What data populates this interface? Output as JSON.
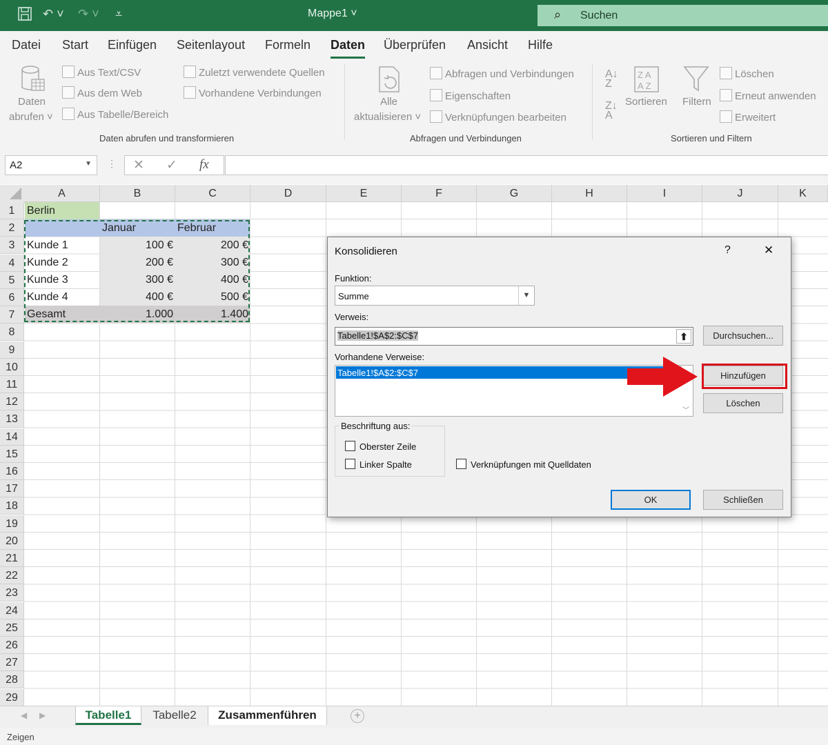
{
  "app": {
    "doc_title": "Mappe1",
    "search_label": "Suchen"
  },
  "tabs": [
    "Datei",
    "Start",
    "Einfügen",
    "Seitenlayout",
    "Formeln",
    "Daten",
    "Überprüfen",
    "Ansicht",
    "Hilfe"
  ],
  "ribbon": {
    "get_data": {
      "line1": "Daten",
      "line2": "abrufen"
    },
    "from_text": "Aus Text/CSV",
    "from_web": "Aus dem Web",
    "from_table": "Aus Tabelle/Bereich",
    "recent_sources": "Zuletzt verwendete Quellen",
    "existing_connections": "Vorhandene Verbindungen",
    "group1": "Daten abrufen und transformieren",
    "refresh_all": {
      "line1": "Alle",
      "line2": "aktualisieren"
    },
    "queries": "Abfragen und Verbindungen",
    "properties": "Eigenschaften",
    "edit_links": "Verknüpfungen bearbeiten",
    "group2": "Abfragen und Verbindungen",
    "sort": "Sortieren",
    "filter": "Filtern",
    "clear": "Löschen",
    "reapply": "Erneut anwenden",
    "advanced": "Erweitert",
    "group3": "Sortieren und Filtern"
  },
  "formula_bar": {
    "name_box": "A2",
    "fx": "fx",
    "formula": ""
  },
  "columns": [
    "A",
    "B",
    "C",
    "D",
    "E",
    "F",
    "G",
    "H",
    "I",
    "J",
    "K"
  ],
  "rows": [
    "1",
    "2",
    "3",
    "4",
    "5",
    "6",
    "7",
    "8",
    "9",
    "10",
    "11",
    "12",
    "13",
    "14",
    "15",
    "16",
    "17",
    "18",
    "19",
    "20",
    "21",
    "22",
    "23",
    "24",
    "25",
    "26",
    "27",
    "28",
    "29"
  ],
  "cells": {
    "a1": "Berlin",
    "header": {
      "b": "Januar",
      "c": "Februar"
    },
    "data": [
      {
        "a": "Kunde 1",
        "b": "100 €",
        "c": "200 €"
      },
      {
        "a": "Kunde 2",
        "b": "200 €",
        "c": "300 €"
      },
      {
        "a": "Kunde 3",
        "b": "300 €",
        "c": "400 €"
      },
      {
        "a": "Kunde 4",
        "b": "400 €",
        "c": "500 €"
      }
    ],
    "total": {
      "a": "Gesamt",
      "b": "1.000",
      "c": "1.400"
    }
  },
  "sheets": [
    "Tabelle1",
    "Tabelle2",
    "Zusammenführen"
  ],
  "status": "Zeigen",
  "dialog": {
    "title": "Konsolidieren",
    "help": "?",
    "close": "✕",
    "function_label": "Funktion:",
    "function_value": "Summe",
    "reference_label": "Verweis:",
    "reference_value": "Tabelle1!$A$2:$C$7",
    "browse_button": "Durchsuchen...",
    "existing_label": "Vorhandene Verweise:",
    "existing_items": [
      "Tabelle1!$A$2:$C$7"
    ],
    "add_button": "Hinzufügen",
    "delete_button": "Löschen",
    "labels_group": "Beschriftung aus:",
    "top_row": "Oberster Zeile",
    "left_column": "Linker Spalte",
    "create_links": "Verknüpfungen mit Quelldaten",
    "ok_button": "OK",
    "close_button": "Schließen"
  },
  "annotation": {
    "arrow_color": "#e2141b",
    "highlight_color": "#d9121b"
  },
  "colors": {
    "excel_green": "#217346",
    "city_fill": "#c6e0b4",
    "header_fill": "#b4c6e7",
    "data_fill": "#e7e6e6",
    "total_fill": "#d0cece"
  }
}
